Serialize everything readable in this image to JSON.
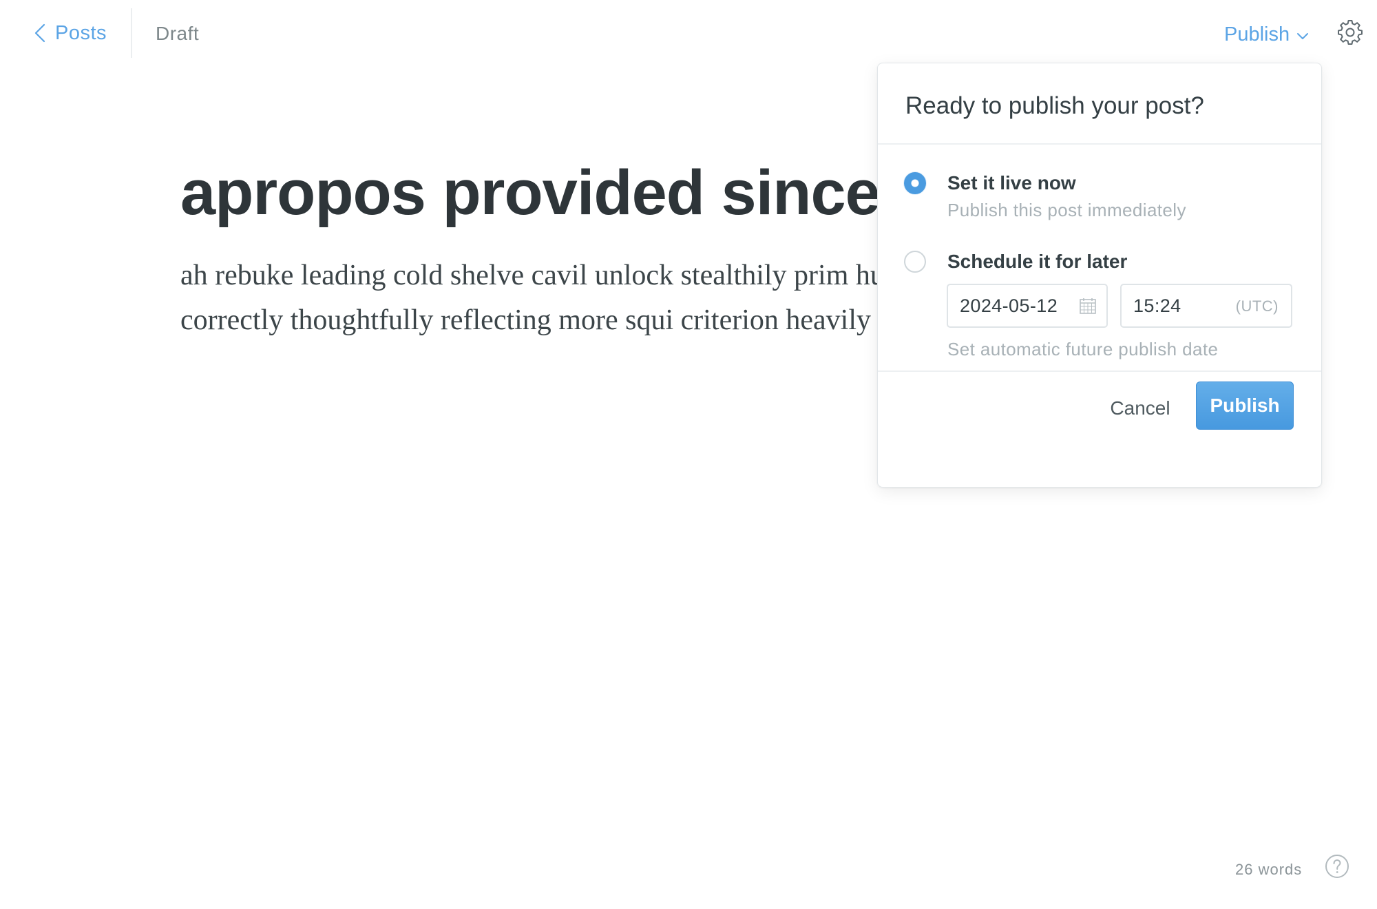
{
  "header": {
    "back_label": "Posts",
    "status": "Draft",
    "publish_label": "Publish"
  },
  "editor": {
    "title": "apropos provided since",
    "body": "ah rebuke leading cold shelve cavil unlock stealthily prim huh gadzooks correctly thoughtfully reflecting more squi criterion heavily vaguely outlying"
  },
  "publish_dialog": {
    "title": "Ready to publish your post?",
    "options": [
      {
        "label": "Set it live now",
        "description": "Publish this post immediately",
        "selected": true
      },
      {
        "label": "Schedule it for later",
        "description": "Set automatic future publish date",
        "selected": false
      }
    ],
    "date_value": "2024-05-12",
    "time_value": "15:24",
    "timezone": "(UTC)",
    "cancel_label": "Cancel",
    "publish_label": "Publish"
  },
  "footer": {
    "word_count": "26 words"
  },
  "colors": {
    "accent": "#5ba4e5",
    "button": "#4a9be0",
    "text": "#343f44",
    "muted": "#a8b1b6"
  },
  "icons": [
    "chevron-left-icon",
    "chevron-down-icon",
    "gear-icon",
    "calendar-icon",
    "help-icon"
  ]
}
